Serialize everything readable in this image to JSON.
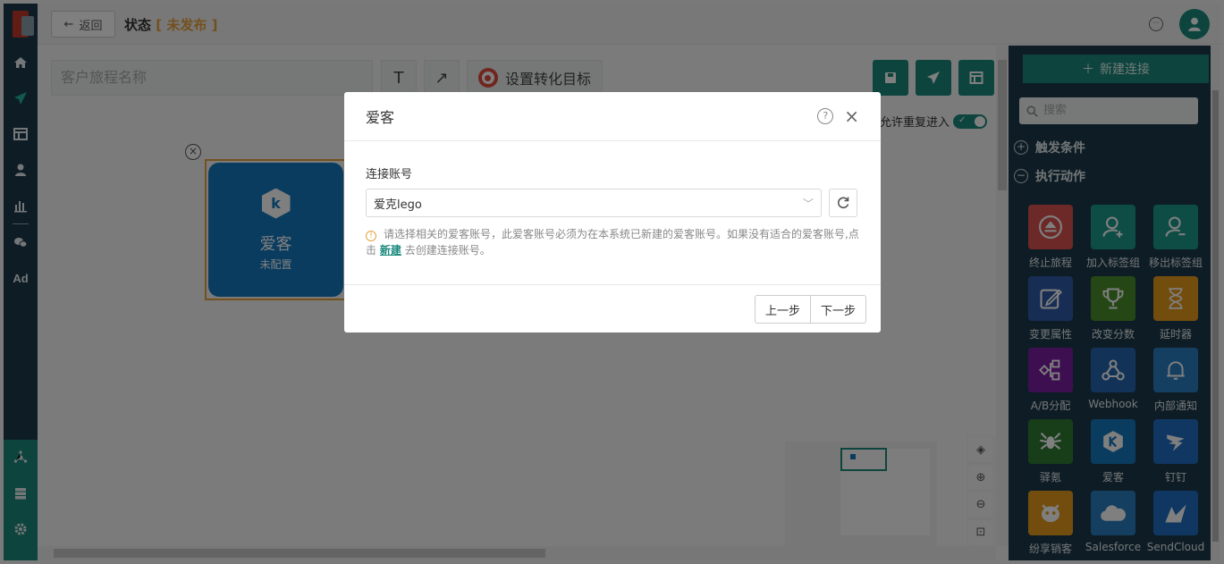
{
  "header": {
    "back_label": "返回",
    "state_prefix": "状态",
    "bracket_open": "[",
    "bracket_close": "]",
    "state_value": "未发布"
  },
  "toolbar": {
    "journey_name_placeholder": "客户旅程名称",
    "text_tool": "T",
    "arrow_tool": "↗",
    "set_goal_label": "设置转化目标",
    "allow_reentry_label": "允许重复进入",
    "allow_reentry_on": true
  },
  "node": {
    "title": "爱客",
    "subtitle": "未配置",
    "logo": "k"
  },
  "right_panel": {
    "new_connection_label": "新建连接",
    "search_placeholder": "搜索",
    "sections": [
      {
        "label": "触发条件",
        "expanded": false
      },
      {
        "label": "执行动作",
        "expanded": true
      }
    ],
    "actions": [
      {
        "label": "终止旅程",
        "color": "#d9534f",
        "icon": "eject-icon"
      },
      {
        "label": "加入标签组",
        "color": "#1a9a8a",
        "icon": "user-plus-icon"
      },
      {
        "label": "移出标签组",
        "color": "#1a9a8a",
        "icon": "user-minus-icon"
      },
      {
        "label": "变更属性",
        "color": "#2e5aa8",
        "icon": "edit-icon"
      },
      {
        "label": "改变分数",
        "color": "#4a8f2a",
        "icon": "trophy-icon"
      },
      {
        "label": "延时器",
        "color": "#e69a1c",
        "icon": "hourglass-icon"
      },
      {
        "label": "A/B分配",
        "color": "#7b1fa2",
        "icon": "split-icon"
      },
      {
        "label": "Webhook",
        "color": "#2565ae",
        "icon": "webhook-icon"
      },
      {
        "label": "内部通知",
        "color": "#2b7fc2",
        "icon": "bell-icon"
      },
      {
        "label": "驿氪",
        "color": "#2e7d32",
        "icon": "spider-icon"
      },
      {
        "label": "爱客",
        "color": "#1579bf",
        "icon": "aike-icon"
      },
      {
        "label": "钉钉",
        "color": "#1e6fc5",
        "icon": "dingtalk-icon"
      },
      {
        "label": "纷享销客",
        "color": "#e69a1c",
        "icon": "fxiaoke-icon"
      },
      {
        "label": "Salesforce",
        "color": "#2b7fc2",
        "icon": "cloud-icon"
      },
      {
        "label": "SendCloud",
        "color": "#1e6fc5",
        "icon": "sendcloud-icon"
      }
    ]
  },
  "dialog": {
    "title": "爱客",
    "field_label": "连接账号",
    "selected_account": "爱克lego",
    "hint_before_link": "请选择相关的爱客账号，此爱客账号必须为在本系统已新建的爱客账号。如果没有适合的爱客账号,点击",
    "hint_link": "新建",
    "hint_after_link": "去创建连接账号。",
    "prev_label": "上一步",
    "next_label": "下一步"
  },
  "colors": {
    "primary": "#1a8a7d",
    "nav_bg": "#1d3a4b",
    "warn": "#e6a23c",
    "node_blue": "#1579bf"
  }
}
